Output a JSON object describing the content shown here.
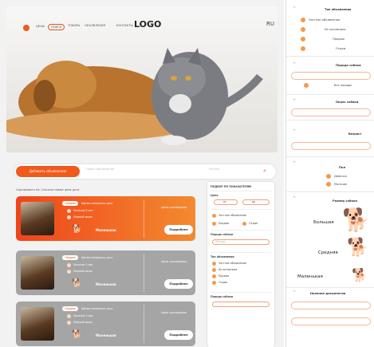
{
  "header": {
    "nav": [
      "ЦЕНЫ",
      "ПОИСК",
      "ТОВАРЫ",
      "ОБЪЯВЛЕНИЯ",
      "КОНТАКТЫ"
    ],
    "logo": "LOGO",
    "lang": "RU"
  },
  "search": {
    "add_label": "Добавить объявление",
    "placeholder": "Поиск объявления",
    "region_placeholder": "Регион"
  },
  "sortbar": "Сортировать по:   Сначала новые   цене   дате",
  "cards": [
    {
      "badge": "Продаю",
      "desc": "Щенок немецкого дога",
      "line1": "Мальчик 5 мес",
      "line2": "Медный окрас",
      "size": "Маленькая",
      "price": "Цена: договорная",
      "more": "Подробнее"
    },
    {
      "badge": "Продаю",
      "desc": "Щенок немецкого дога",
      "line1": "Мальчик 5 мес",
      "line2": "Медный окрас",
      "size": "Маленькая",
      "price": "Цена: договорная",
      "more": "Подробнее"
    },
    {
      "badge": "Продаю",
      "desc": "Щенок немецкого дога",
      "line1": "Мальчик 5 мес",
      "line2": "Медный окрас",
      "size": "Маленькая",
      "price": "Цена: договорная",
      "more": "Подробнее"
    }
  ],
  "filters": {
    "title": "ПОДБОР ПО ПОКАЗАТЕЛЯМ",
    "price_label": "Цена",
    "from": "от",
    "to": "до",
    "type_label": "Тип объявления",
    "breed_label": "Порода собаки",
    "opts": [
      "Частное объявление",
      "Из питомника",
      "Продаю",
      "Отдам"
    ],
    "breed_hint": "Порода"
  },
  "sidebar": {
    "sec1_title": "Тип объявления",
    "sec1_opts": [
      "Частное объявление",
      "Из питомника",
      "Продаю",
      "Отдам"
    ],
    "sec2_title": "Порода собаки",
    "sec2_opt": "Все породы",
    "sec3_title": "Окрас собаки",
    "sec4_title": "Возраст",
    "sec5_title": "Пол",
    "sec5_opts": [
      "Девочка",
      "Мальчик"
    ],
    "sec6_title": "Размер собаки",
    "sizes": [
      "Большая",
      "Средняя",
      "Маленькая"
    ],
    "sec7_title": "Наличие документов"
  },
  "colors": {
    "accent": "#f05a1c",
    "card_active": "#f0441a",
    "card_gray": "#a5a5a5"
  }
}
